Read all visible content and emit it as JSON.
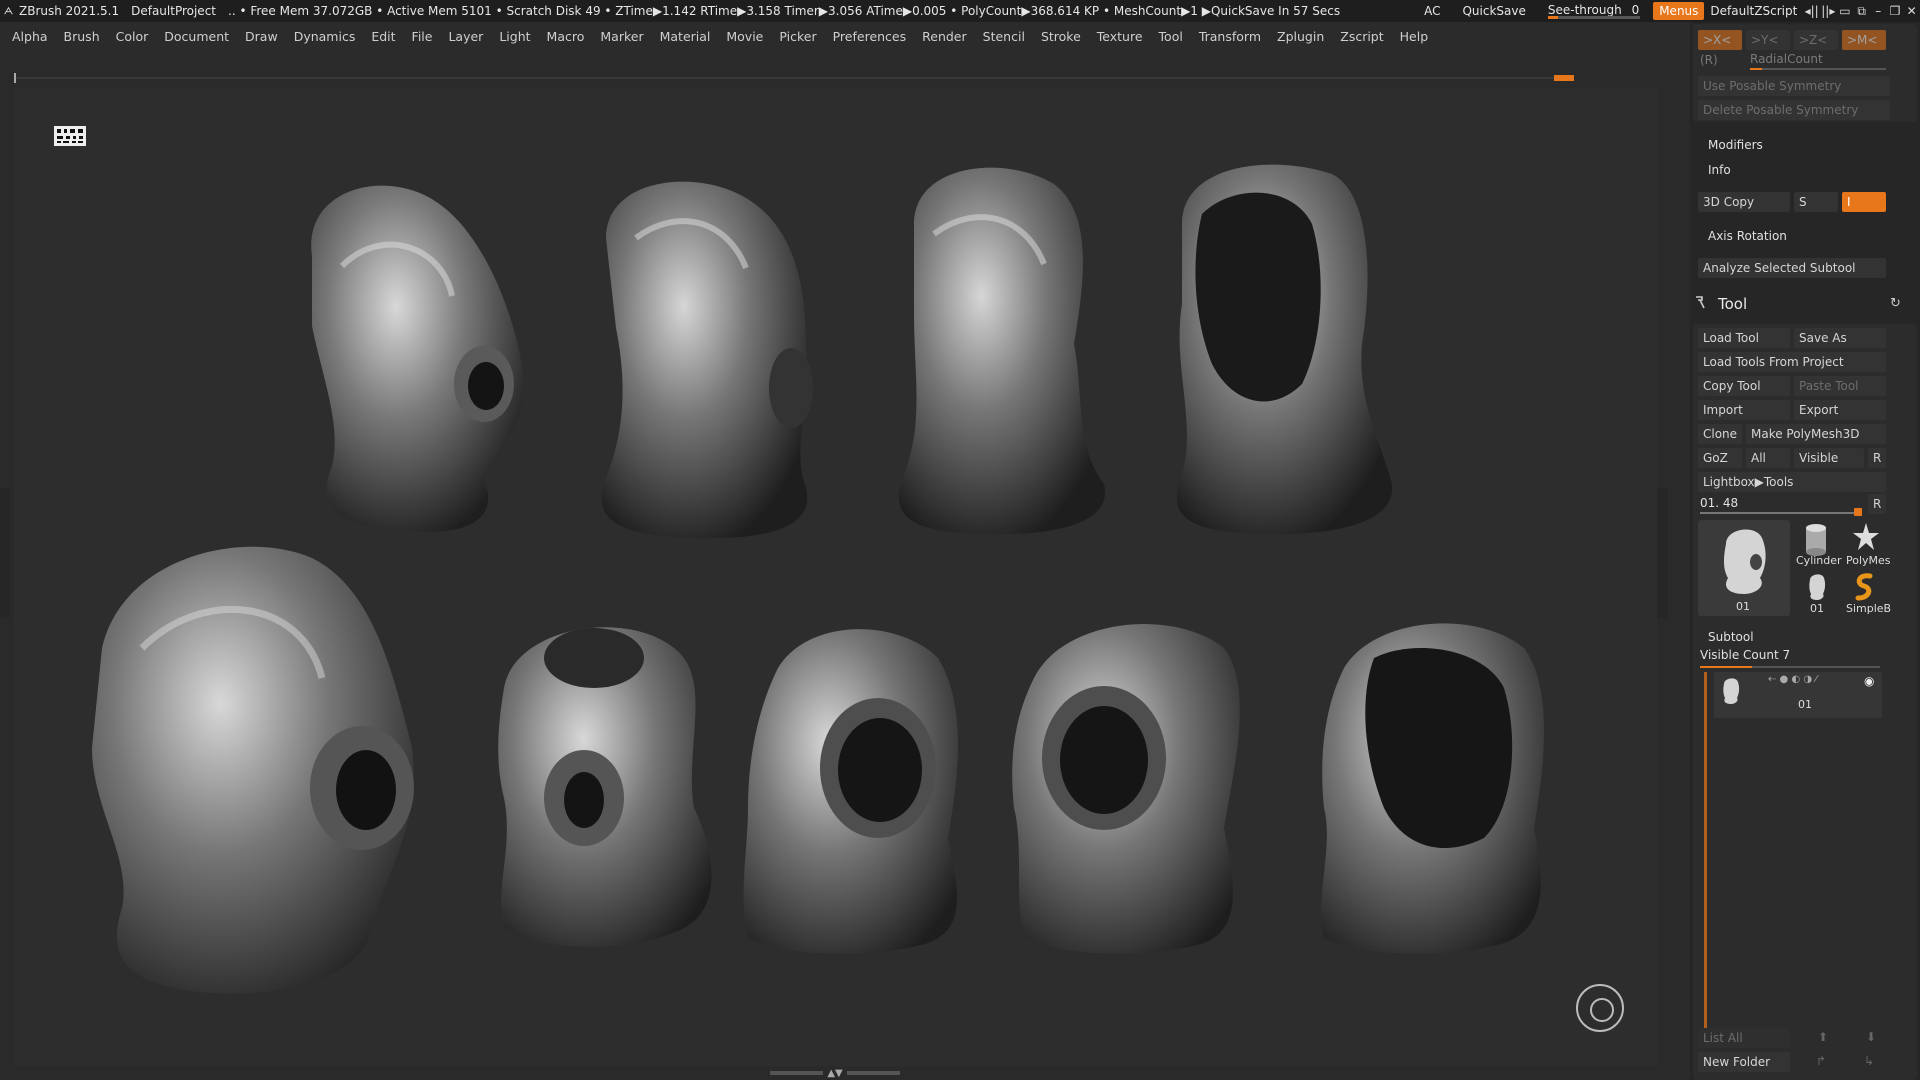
{
  "titlebar": {
    "app": "ZBrush 2021.5.1",
    "project": "DefaultProject",
    "stats": ".. • Free Mem 37.072GB • Active Mem 5101 • Scratch Disk 49 • ZTime▶1.142 RTime▶3.158 Timer▶3.056 ATime▶0.005 • PolyCount▶368.614 KP • MeshCount▶1 ▶QuickSave In 57 Secs",
    "ac": "AC",
    "quicksave": "QuickSave",
    "seethrough_label": "See-through",
    "seethrough_value": "0",
    "menus": "Menus",
    "script": "DefaultZScript"
  },
  "menubar": [
    "Alpha",
    "Brush",
    "Color",
    "Document",
    "Draw",
    "Dynamics",
    "Edit",
    "File",
    "Layer",
    "Light",
    "Macro",
    "Marker",
    "Material",
    "Movie",
    "Picker",
    "Preferences",
    "Render",
    "Stencil",
    "Stroke",
    "Texture",
    "Tool",
    "Transform",
    "Zplugin",
    "Zscript",
    "Help"
  ],
  "panel": {
    "sym_x": ">X<",
    "sym_y": ">Y<",
    "sym_z": ">Z<",
    "sym_m": ">M<",
    "sym_r": "(R)",
    "radialcount": "RadialCount",
    "use_posable": "Use Posable Symmetry",
    "delete_posable": "Delete Posable Symmetry",
    "modifiers": "Modifiers",
    "info": "Info",
    "copy3d": "3D Copy",
    "copy3d_s": "S",
    "copy3d_i": "I",
    "axis_rotation": "Axis Rotation",
    "analyze": "Analyze Selected Subtool",
    "tool_title": "Tool",
    "load_tool": "Load Tool",
    "save_as": "Save As",
    "load_from_project": "Load Tools From Project",
    "copy_tool": "Copy Tool",
    "paste_tool": "Paste Tool",
    "import": "Import",
    "export": "Export",
    "clone": "Clone",
    "make_polymesh": "Make PolyMesh3D",
    "goz": "GoZ",
    "all": "All",
    "visible": "Visible",
    "r": "R",
    "lightbox_tools": "Lightbox▶Tools",
    "tool_slider_label": "01. 48",
    "tool_slider_r": "R",
    "thumb_main": "01",
    "thumb_cyl": "Cylinder",
    "thumb_poly": "PolyMes",
    "thumb_small": "01",
    "thumb_simple": "SimpleB",
    "subtool": "Subtool",
    "visible_count": "Visible Count 7",
    "subtool_item": "01",
    "list_all": "List All",
    "new_folder": "New Folder"
  }
}
